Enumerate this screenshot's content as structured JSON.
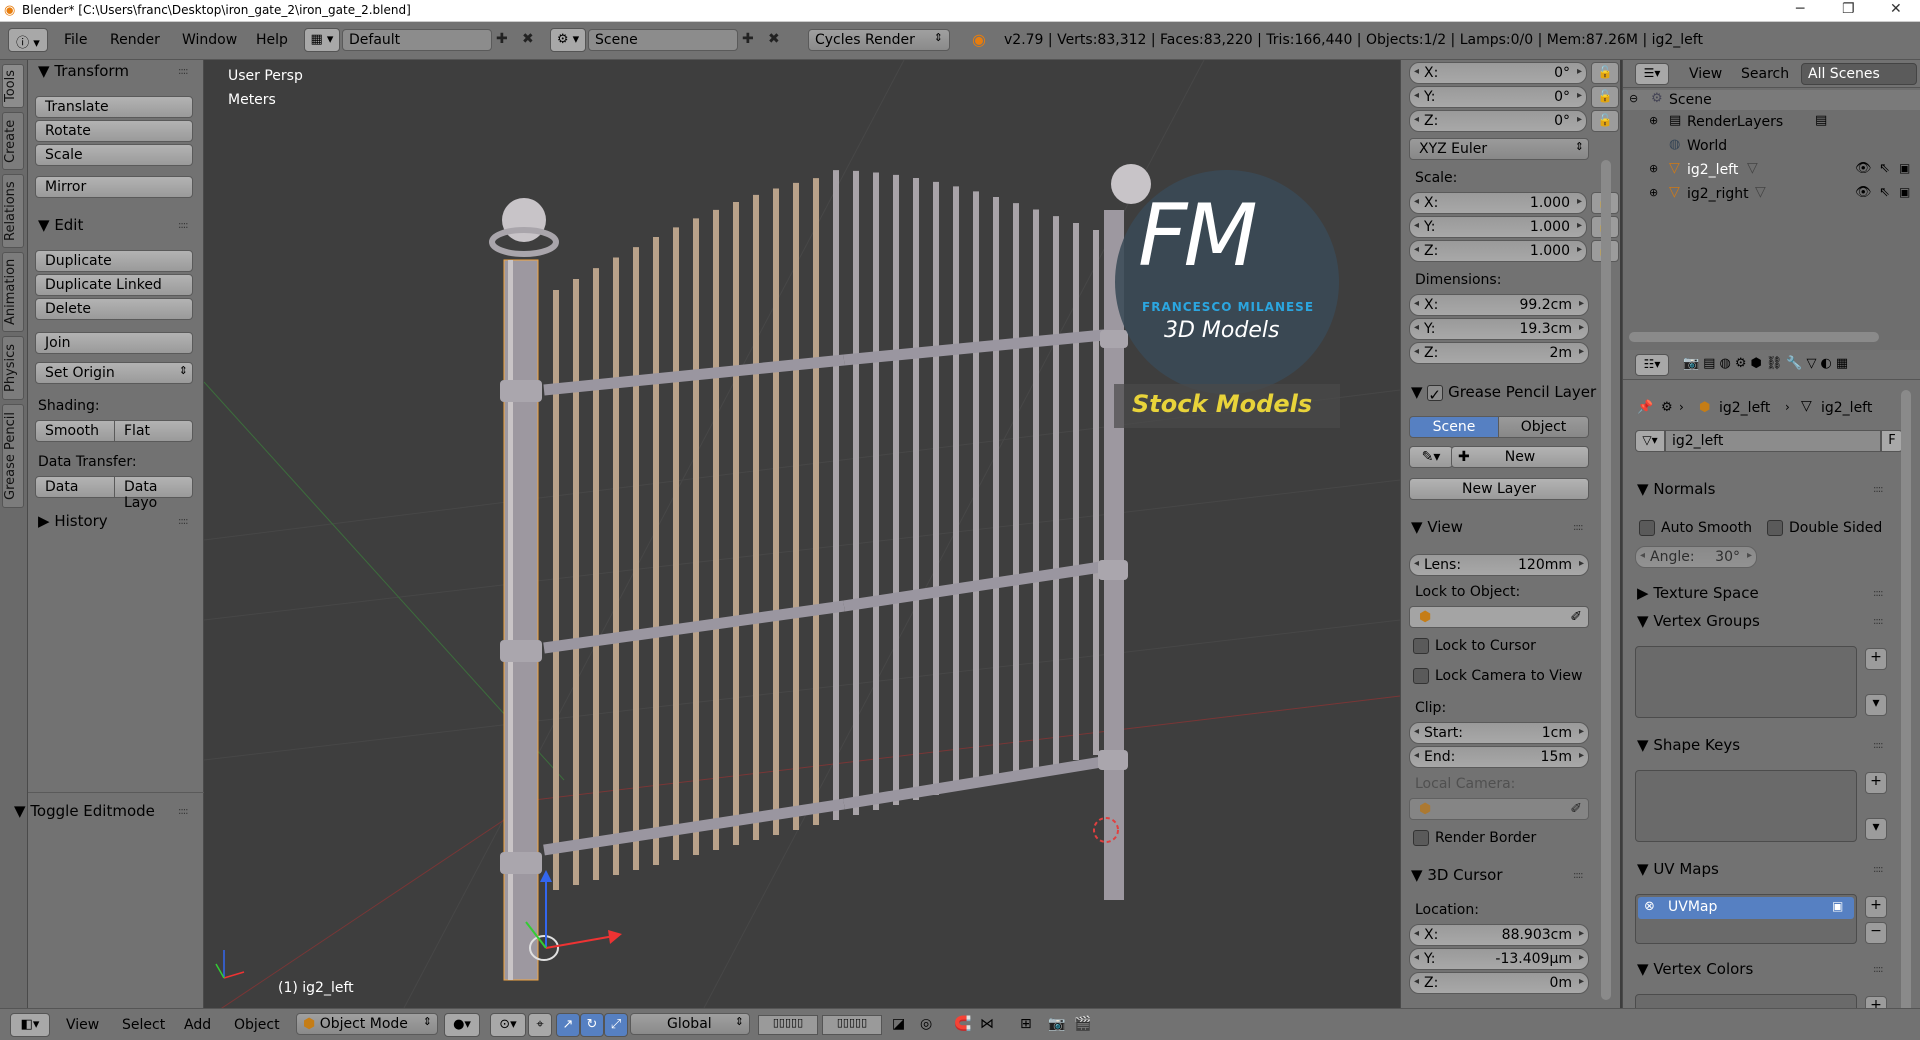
{
  "window": {
    "title": "Blender* [C:\\Users\\franc\\Desktop\\iron_gate_2\\iron_gate_2.blend]",
    "minimize": "─",
    "maximize": "❐",
    "close": "✕"
  },
  "menubar": {
    "menus": [
      "File",
      "Render",
      "Window",
      "Help"
    ],
    "layout": "Default",
    "scene": "Scene",
    "engine": "Cycles Render",
    "stats": "v2.79 | Verts:83,312 | Faces:83,220 | Tris:166,440 | Objects:1/2 | Lamps:0/0 | Mem:87.26M | ig2_left"
  },
  "lefttabs": [
    "Tools",
    "Create",
    "Relations",
    "Animation",
    "Physics",
    "Grease Pencil"
  ],
  "toolshelf": {
    "transform_header": "Transform",
    "transform_buttons": [
      "Translate",
      "Rotate",
      "Scale"
    ],
    "mirror": "Mirror",
    "edit_header": "Edit",
    "edit_buttons": [
      "Duplicate",
      "Duplicate Linked",
      "Delete"
    ],
    "join": "Join",
    "set_origin": "Set Origin",
    "shading_label": "Shading:",
    "smooth": "Smooth",
    "flat": "Flat",
    "data_transfer_label": "Data Transfer:",
    "data": "Data",
    "data_layout": "Data Layo",
    "history": "History",
    "toggle_editmode": "Toggle Editmode"
  },
  "viewport": {
    "view_name": "User Persp",
    "units": "Meters",
    "selected": "(1) ig2_left",
    "watermark_fm": "FM",
    "watermark_name": "FRANCESCO MILANESE",
    "watermark_sub": "3D Models",
    "watermark_stock": "Stock Models"
  },
  "npanel": {
    "rotation": [
      {
        "axis": "X:",
        "value": "0°"
      },
      {
        "axis": "Y:",
        "value": "0°"
      },
      {
        "axis": "Z:",
        "value": "0°"
      }
    ],
    "rotation_mode": "XYZ Euler",
    "scale_label": "Scale:",
    "scale": [
      {
        "axis": "X:",
        "value": "1.000"
      },
      {
        "axis": "Y:",
        "value": "1.000"
      },
      {
        "axis": "Z:",
        "value": "1.000"
      }
    ],
    "dimensions_label": "Dimensions:",
    "dimensions": [
      {
        "axis": "X:",
        "value": "99.2cm"
      },
      {
        "axis": "Y:",
        "value": "19.3cm"
      },
      {
        "axis": "Z:",
        "value": "2m"
      }
    ],
    "grease_header": "Grease Pencil Layer",
    "gp_scene": "Scene",
    "gp_object": "Object",
    "gp_new": "New",
    "gp_new_layer": "New Layer",
    "view_header": "View",
    "lens_label": "Lens:",
    "lens_value": "120mm",
    "lock_to_object": "Lock to Object:",
    "lock_to_cursor": "Lock to Cursor",
    "lock_camera": "Lock Camera to View",
    "clip_label": "Clip:",
    "clip_start_label": "Start:",
    "clip_start": "1cm",
    "clip_end_label": "End:",
    "clip_end": "15m",
    "local_camera": "Local Camera:",
    "render_border": "Render Border",
    "cursor_header": "3D Cursor",
    "location_label": "Location:",
    "cursor": [
      {
        "axis": "X:",
        "value": "88.903cm"
      },
      {
        "axis": "Y:",
        "value": "-13.409µm"
      },
      {
        "axis": "Z:",
        "value": "0m"
      }
    ]
  },
  "outliner": {
    "view": "View",
    "search": "Search",
    "filter": "All Scenes",
    "items": [
      {
        "label": "Scene",
        "icon": "scene-icon"
      },
      {
        "label": "RenderLayers",
        "icon": "render-layers-icon"
      },
      {
        "label": "World",
        "icon": "world-icon"
      },
      {
        "label": "ig2_left",
        "icon": "mesh-icon"
      },
      {
        "label": "ig2_right",
        "icon": "mesh-icon"
      }
    ]
  },
  "properties": {
    "breadcrumb": [
      "ig2_left",
      "ig2_left"
    ],
    "mesh_name": "ig2_left",
    "fake_user": "F",
    "normals_header": "Normals",
    "auto_smooth": "Auto Smooth",
    "double_sided": "Double Sided",
    "angle_label": "Angle:",
    "angle_value": "30°",
    "texture_space": "Texture Space",
    "vertex_groups": "Vertex Groups",
    "shape_keys": "Shape Keys",
    "uv_maps": "UV Maps",
    "uv_map_name": "UVMap",
    "vertex_colors": "Vertex Colors"
  },
  "bottombar": {
    "menus": [
      "View",
      "Select",
      "Add",
      "Object"
    ],
    "mode": "Object Mode",
    "orientation": "Global"
  },
  "colors": {
    "accent_blue": "#5680c2",
    "selected_orange": "#f4a641",
    "watermark_blue": "#2ba6e0",
    "stock_yellow": "#e8d33a"
  }
}
